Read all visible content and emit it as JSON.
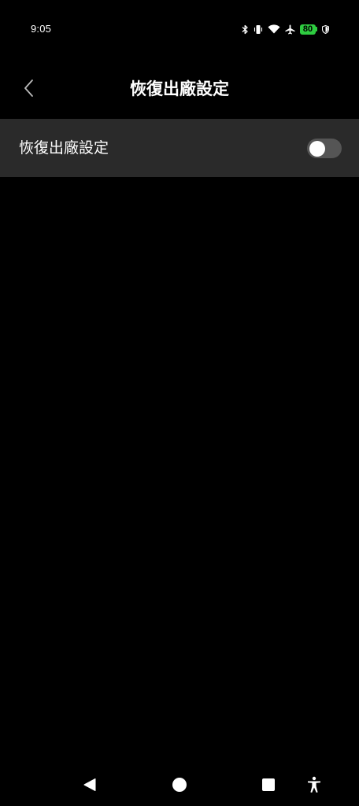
{
  "status_bar": {
    "time": "9:05",
    "icons": [
      "bluetooth-icon",
      "vibrate-icon",
      "wifi-icon",
      "airplane-icon",
      "battery-icon",
      "shield-icon"
    ],
    "battery_level": "80",
    "battery_color": "#2ecc40"
  },
  "header": {
    "title": "恢復出廠設定",
    "back_icon": "chevron-left-icon"
  },
  "settings": {
    "row_label": "恢復出廠設定",
    "toggle_state": "off",
    "row_background": "#2a2a2a"
  },
  "nav_bar": {
    "buttons": [
      "back-triangle-icon",
      "home-circle-icon",
      "recents-square-icon",
      "accessibility-icon"
    ]
  },
  "colors": {
    "background": "#000000",
    "text": "#ffffff",
    "toggle_track_off": "#555555"
  }
}
